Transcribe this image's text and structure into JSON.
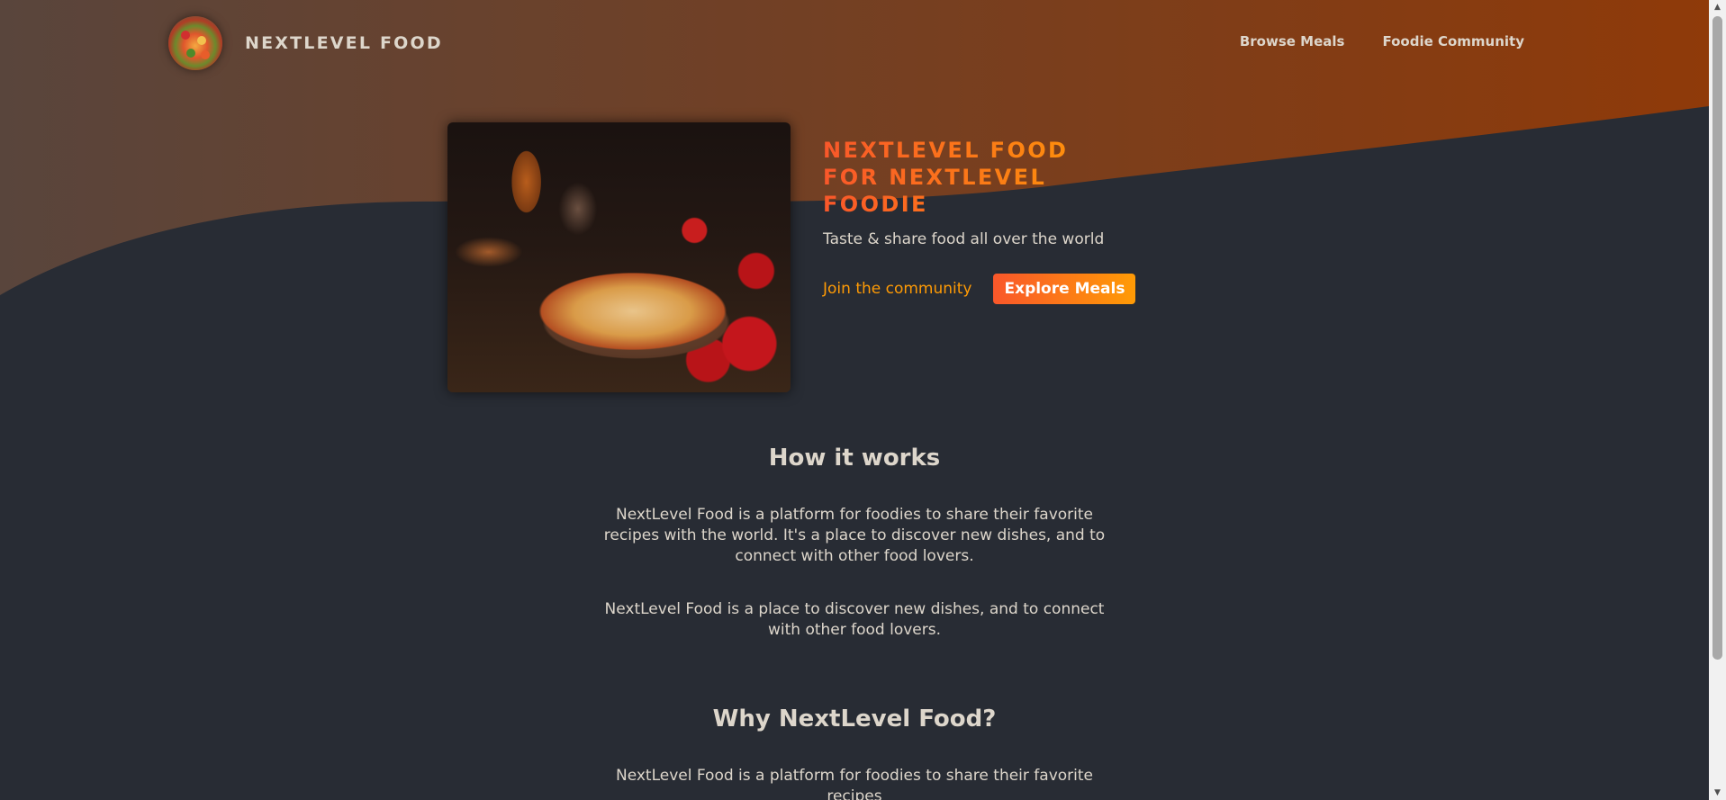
{
  "header": {
    "logo_text": "NextLevel Food",
    "nav": [
      {
        "label": "Browse Meals"
      },
      {
        "label": "Foodie Community"
      }
    ]
  },
  "hero": {
    "title": "NextLevel Food for NextLevel Foodie",
    "subtitle": "Taste & share food all over the world",
    "join_link": "Join the community",
    "explore_button": "Explore Meals"
  },
  "how_it_works": {
    "heading": "How it works",
    "paragraph_1": "NextLevel Food is a platform for foodies to share their favorite recipes with the world. It's a place to discover new dishes, and to connect with other food lovers.",
    "paragraph_2": "NextLevel Food is a place to discover new dishes, and to connect with other food lovers."
  },
  "why": {
    "heading": "Why NextLevel Food?",
    "paragraph_1": "NextLevel Food is a platform for foodies to share their favorite recipes"
  },
  "colors": {
    "background": "#282c34",
    "accent_start": "#f9572a",
    "accent_end": "#ff9b05",
    "text": "#ddd6cb"
  },
  "icons": {
    "logo": "food-plate-logo-icon",
    "scroll_up": "chevron-up-icon",
    "scroll_down": "chevron-down-icon"
  }
}
